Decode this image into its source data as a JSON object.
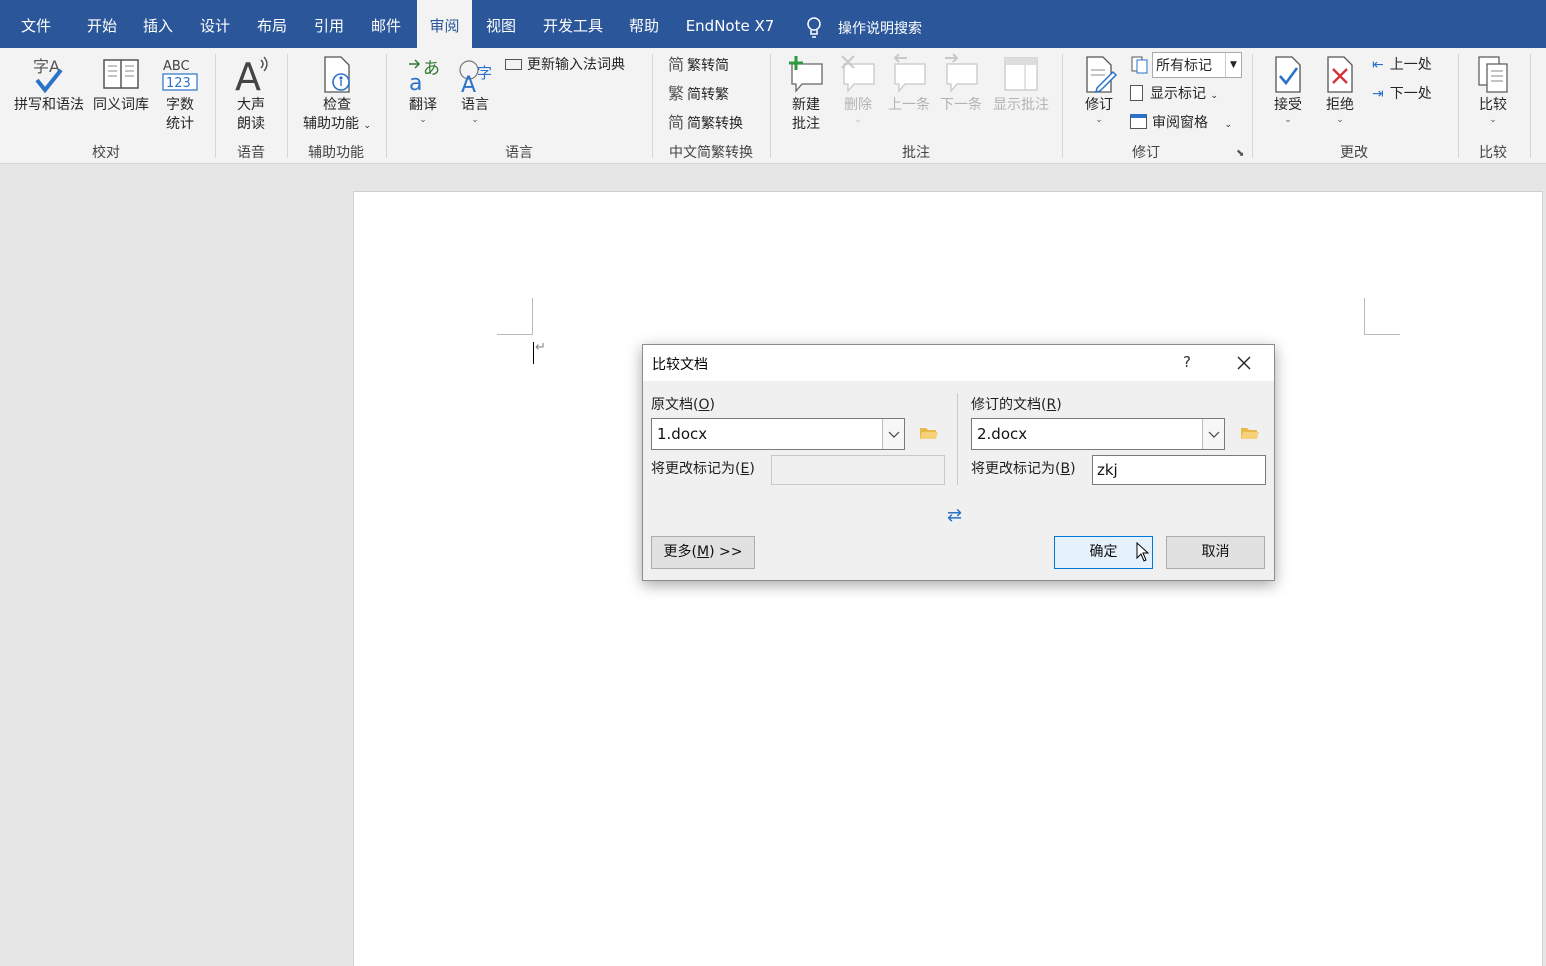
{
  "menubar": {
    "tabs": [
      "文件",
      "开始",
      "插入",
      "设计",
      "布局",
      "引用",
      "邮件",
      "审阅",
      "视图",
      "开发工具",
      "帮助",
      "EndNote X7"
    ],
    "active_tab": "审阅",
    "search_label": "操作说明搜索",
    "color": "#2b579a"
  },
  "ribbon": {
    "proofing": {
      "spelling": "拼写和语法",
      "thesaurus": "同义词库",
      "wordcount_line1": "字数",
      "wordcount_line2": "统计",
      "group": "校对"
    },
    "speech": {
      "read_line1": "大声",
      "read_line2": "朗读",
      "group": "语音"
    },
    "accessibility": {
      "check_line1": "检查",
      "check_line2": "辅助功能",
      "group": "辅助功能"
    },
    "language": {
      "translate": "翻译",
      "language": "语言",
      "update_ime": "更新输入法词典",
      "group": "语言"
    },
    "chinese": {
      "to_simplified": "繁转简",
      "to_traditional": "简转繁",
      "convert": "简繁转换",
      "group": "中文简繁转换"
    },
    "comments": {
      "new_line1": "新建",
      "new_line2": "批注",
      "delete": "删除",
      "previous": "上一条",
      "next": "下一条",
      "show": "显示批注",
      "group": "批注"
    },
    "tracking": {
      "track": "修订",
      "markup_select": "所有标记",
      "show_markup": "显示标记",
      "review_pane": "审阅窗格",
      "group": "修订"
    },
    "changes": {
      "accept": "接受",
      "reject": "拒绝",
      "previous": "上一处",
      "next": "下一处",
      "group": "更改"
    },
    "compare": {
      "compare": "比较",
      "group": "比较"
    }
  },
  "dialog": {
    "title": "比较文档",
    "help": "?",
    "original": {
      "label": "原文档(",
      "key": "O",
      "label_end": ")",
      "value": "1.docx",
      "mark_label": "将更改标记为(",
      "mark_key": "E",
      "mark_end": ")",
      "mark_value": ""
    },
    "revised": {
      "label": "修订的文档(",
      "key": "R",
      "label_end": ")",
      "value": "2.docx",
      "mark_label": "将更改标记为(",
      "mark_key": "B",
      "mark_end": ")",
      "mark_value": "zkj"
    },
    "swap_glyph": "⇄",
    "more_button": {
      "label": "更多(",
      "key": "M",
      "label_end": ") >>"
    },
    "ok_button": "确定",
    "cancel_button": "取消"
  },
  "document": {
    "paragraph_mark": "↵"
  }
}
